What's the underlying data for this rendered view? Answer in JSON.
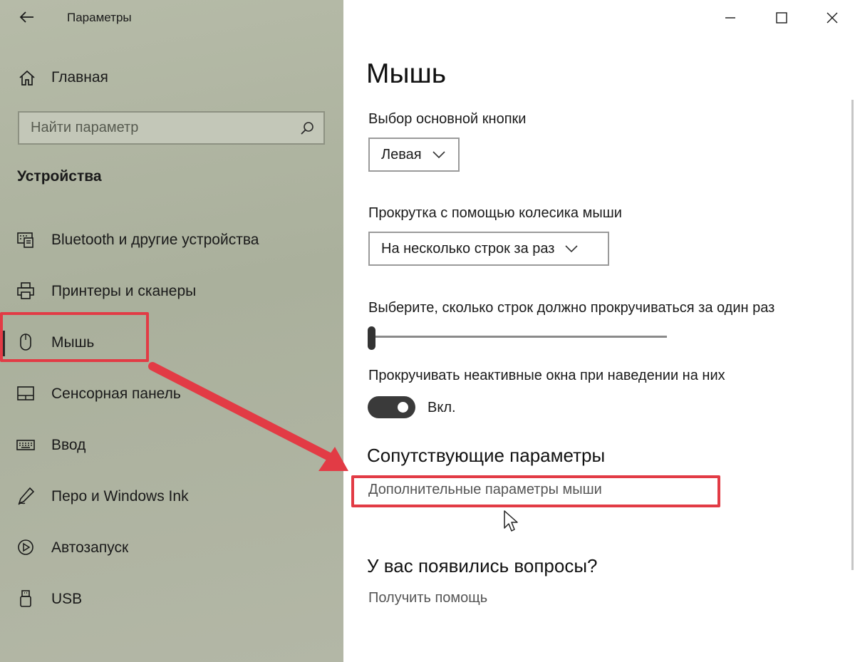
{
  "window": {
    "title": "Параметры",
    "back_icon": "back-arrow-icon",
    "controls": [
      "minimize-icon",
      "maximize-icon",
      "close-icon"
    ]
  },
  "sidebar": {
    "home_label": "Главная",
    "search_placeholder": "Найти параметр",
    "section_title": "Устройства",
    "items": [
      {
        "label": "Bluetooth и другие устройства",
        "icon": "bluetooth-devices-icon"
      },
      {
        "label": "Принтеры и сканеры",
        "icon": "printer-icon"
      },
      {
        "label": "Мышь",
        "icon": "mouse-icon",
        "selected": true
      },
      {
        "label": "Сенсорная панель",
        "icon": "touchpad-icon"
      },
      {
        "label": "Ввод",
        "icon": "keyboard-icon"
      },
      {
        "label": "Перо и Windows Ink",
        "icon": "pen-icon"
      },
      {
        "label": "Автозапуск",
        "icon": "autoplay-icon"
      },
      {
        "label": "USB",
        "icon": "usb-icon"
      }
    ]
  },
  "main": {
    "title": "Мышь",
    "primary_button": {
      "label": "Выбор основной кнопки",
      "value": "Левая"
    },
    "wheel_scroll": {
      "label": "Прокрутка с помощью колесика мыши",
      "value": "На несколько строк за раз"
    },
    "lines_to_scroll": {
      "label": "Выберите, сколько строк должно прокручиваться за один раз",
      "level": 0.0
    },
    "inactive_scroll": {
      "label": "Прокручивать неактивные окна при наведении на них",
      "state_label": "Вкл.",
      "on": true
    },
    "related": {
      "heading": "Сопутствующие параметры",
      "link": "Дополнительные параметры мыши"
    },
    "questions": {
      "heading": "У вас появились вопросы?",
      "link": "Получить помощь"
    }
  },
  "annotation": {
    "highlight_color": "#e23b45"
  },
  "colors": {
    "sidebar_bg": "#b1b6a3",
    "main_bg": "#ffffff",
    "toggle_on": "#3a3a3a"
  }
}
